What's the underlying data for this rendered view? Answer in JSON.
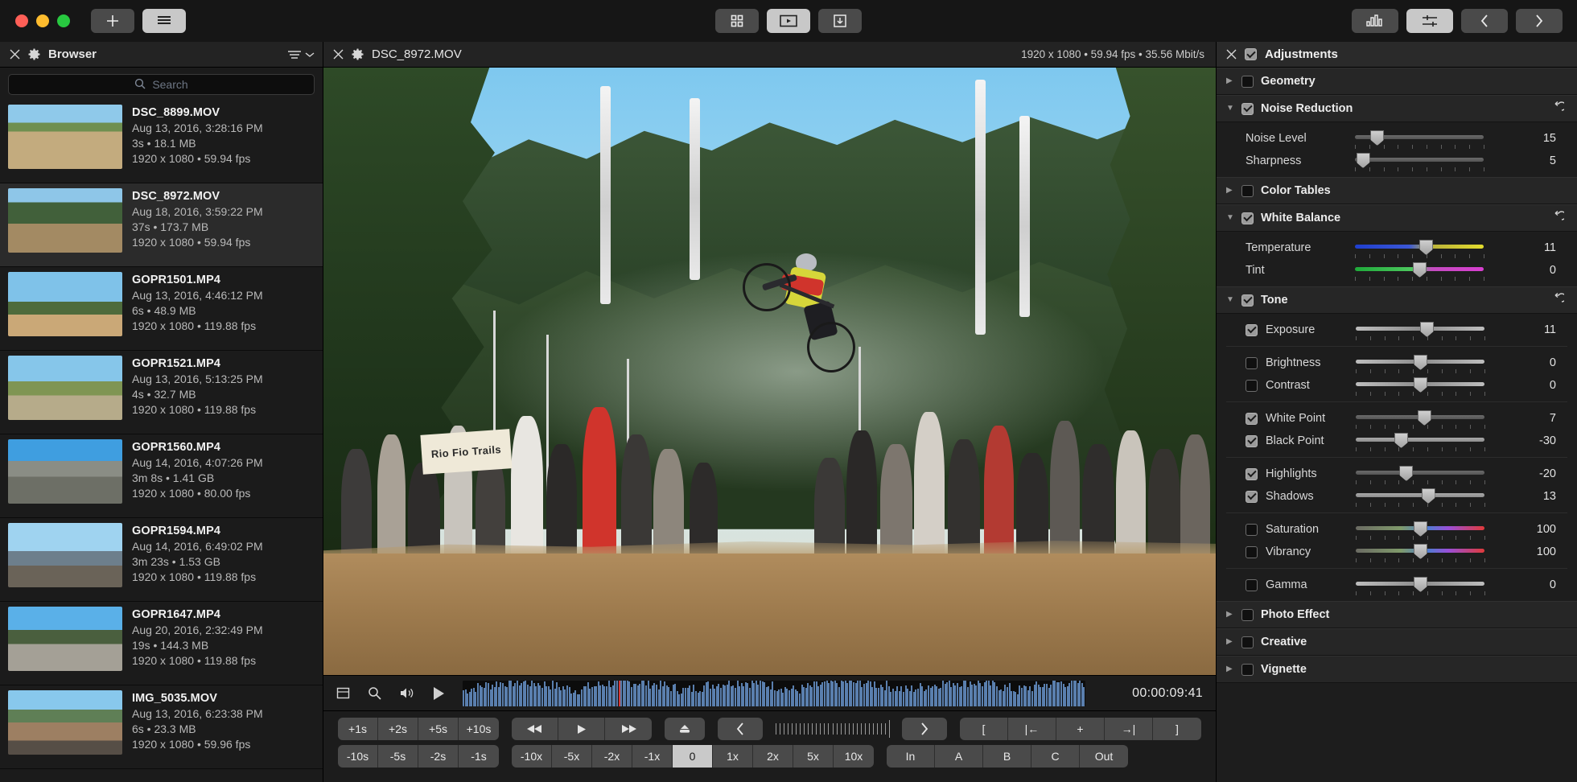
{
  "titlebar": {
    "add_label": "+",
    "buttons": {
      "add": "add-button",
      "list": "list-view-button",
      "grid": "grid-view-button",
      "player": "player-view-button",
      "export": "export-button",
      "scope": "scopes-button",
      "adjust": "adjustments-button",
      "prev": "previous-button",
      "next": "next-button"
    }
  },
  "browser": {
    "title": "Browser",
    "search": {
      "placeholder": "Search",
      "value": ""
    },
    "clips": [
      {
        "name": "DSC_8899.MOV",
        "date": "Aug 13, 2016, 3:28:16 PM",
        "size": "3s • 18.1 MB",
        "format": "1920 x 1080 • 59.94 fps",
        "selected": false
      },
      {
        "name": "DSC_8972.MOV",
        "date": "Aug 18, 2016, 3:59:22 PM",
        "size": "37s • 173.7 MB",
        "format": "1920 x 1080 • 59.94 fps",
        "selected": true
      },
      {
        "name": "GOPR1501.MP4",
        "date": "Aug 13, 2016, 4:46:12 PM",
        "size": "6s • 48.9 MB",
        "format": "1920 x 1080 • 119.88 fps",
        "selected": false
      },
      {
        "name": "GOPR1521.MP4",
        "date": "Aug 13, 2016, 5:13:25 PM",
        "size": "4s • 32.7 MB",
        "format": "1920 x 1080 • 119.88 fps",
        "selected": false
      },
      {
        "name": "GOPR1560.MP4",
        "date": "Aug 14, 2016, 4:07:26 PM",
        "size": "3m 8s • 1.41 GB",
        "format": "1920 x 1080 • 80.00 fps",
        "selected": false
      },
      {
        "name": "GOPR1594.MP4",
        "date": "Aug 14, 2016, 6:49:02 PM",
        "size": "3m 23s • 1.53 GB",
        "format": "1920 x 1080 • 119.88 fps",
        "selected": false
      },
      {
        "name": "GOPR1647.MP4",
        "date": "Aug 20, 2016, 2:32:49 PM",
        "size": "19s • 144.3 MB",
        "format": "1920 x 1080 • 119.88 fps",
        "selected": false
      },
      {
        "name": "IMG_5035.MOV",
        "date": "Aug 13, 2016, 6:23:38 PM",
        "size": "6s • 23.3 MB",
        "format": "1920 x 1080 • 59.96 fps",
        "selected": false
      }
    ]
  },
  "viewer": {
    "title": "DSC_8972.MOV",
    "info": "1920 x 1080 • 59.94 fps • 35.56 Mbit/s",
    "scene_sign_text": "Rio Fio Trails",
    "timecode": "00:00:09:41",
    "playhead_percent": 25
  },
  "transport": {
    "row1_steps": [
      "+1s",
      "+2s",
      "+5s",
      "+10s"
    ],
    "row2_steps": [
      "-10s",
      "-5s",
      "-2s",
      "-1s"
    ],
    "playback": [
      "rewind-icon",
      "play-icon",
      "fast-forward-icon"
    ],
    "speeds": [
      "-10x",
      "-5x",
      "-2x",
      "-1x",
      "0",
      "1x",
      "2x",
      "5x",
      "10x"
    ],
    "active_speed": "0",
    "marks": [
      "[",
      "|←",
      "+",
      "→|",
      "]"
    ],
    "range": [
      "In",
      "A",
      "B",
      "C",
      "Out"
    ]
  },
  "adjustments": {
    "title": "Adjustments",
    "enabled": true,
    "groups": [
      {
        "name": "Geometry",
        "expanded": false,
        "checked": false,
        "has_reset": false,
        "rows": []
      },
      {
        "name": "Noise Reduction",
        "expanded": true,
        "checked": true,
        "has_reset": true,
        "rows": [
          {
            "label": "Noise Level",
            "value": "15",
            "pos": 17,
            "track": "dark",
            "checkbox": null
          },
          {
            "label": "Sharpness",
            "value": "5",
            "pos": 6,
            "track": "dark",
            "checkbox": null
          }
        ]
      },
      {
        "name": "Color Tables",
        "expanded": false,
        "checked": false,
        "has_reset": false,
        "rows": []
      },
      {
        "name": "White Balance",
        "expanded": true,
        "checked": true,
        "has_reset": true,
        "rows": [
          {
            "label": "Temperature",
            "value": "11",
            "pos": 55,
            "track": "temp",
            "checkbox": null
          },
          {
            "label": "Tint",
            "value": "0",
            "pos": 50,
            "track": "tint",
            "checkbox": null
          }
        ]
      },
      {
        "name": "Tone",
        "expanded": true,
        "checked": true,
        "has_reset": true,
        "rows": [
          {
            "label": "Exposure",
            "value": "11",
            "pos": 55,
            "track": "split",
            "checkbox": true
          },
          {
            "divider": true
          },
          {
            "label": "Brightness",
            "value": "0",
            "pos": 50,
            "track": "split",
            "checkbox": false
          },
          {
            "label": "Contrast",
            "value": "0",
            "pos": 50,
            "track": "split",
            "checkbox": false
          },
          {
            "divider": true
          },
          {
            "label": "White Point",
            "value": "7",
            "pos": 53,
            "track": "dark",
            "checkbox": true
          },
          {
            "label": "Black Point",
            "value": "-30",
            "pos": 35,
            "track": "plain",
            "checkbox": true
          },
          {
            "divider": true
          },
          {
            "label": "Highlights",
            "value": "-20",
            "pos": 39,
            "track": "dark",
            "checkbox": true
          },
          {
            "label": "Shadows",
            "value": "13",
            "pos": 56,
            "track": "plain",
            "checkbox": true
          },
          {
            "divider": true
          },
          {
            "label": "Saturation",
            "value": "100",
            "pos": 50,
            "track": "sat",
            "checkbox": false
          },
          {
            "label": "Vibrancy",
            "value": "100",
            "pos": 50,
            "track": "sat",
            "checkbox": false
          },
          {
            "divider": true
          },
          {
            "label": "Gamma",
            "value": "0",
            "pos": 50,
            "track": "split",
            "checkbox": false
          }
        ]
      },
      {
        "name": "Photo Effect",
        "expanded": false,
        "checked": false,
        "has_reset": false,
        "rows": []
      },
      {
        "name": "Creative",
        "expanded": false,
        "checked": false,
        "has_reset": false,
        "rows": []
      },
      {
        "name": "Vignette",
        "expanded": false,
        "checked": false,
        "has_reset": false,
        "rows": []
      }
    ]
  },
  "colors": {
    "accent_blue": "#5a7fae",
    "playhead_red": "#d23b3b",
    "panel_bg": "#1d1d1d",
    "header_bg": "#262626"
  }
}
